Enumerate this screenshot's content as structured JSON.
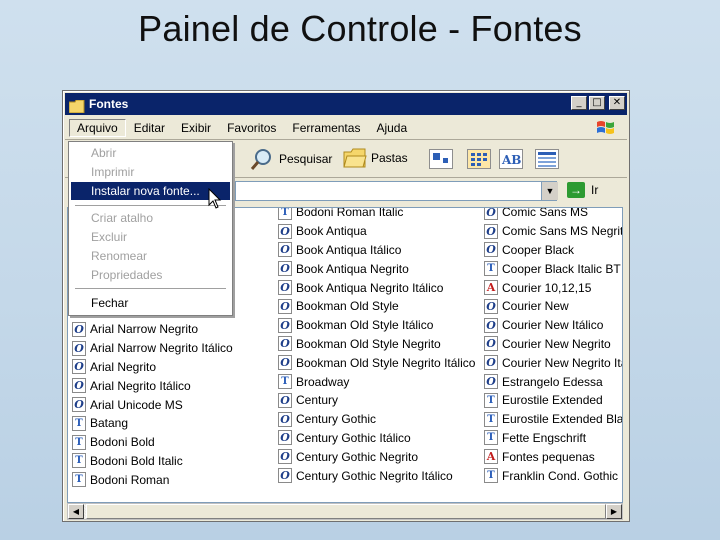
{
  "slide": {
    "title": "Painel de Controle - Fontes"
  },
  "window": {
    "title": "Fontes",
    "buttons": {
      "minimize": "_",
      "maximize": "□",
      "close": "✕"
    }
  },
  "menubar": {
    "items": [
      "Arquivo",
      "Editar",
      "Exibir",
      "Favoritos",
      "Ferramentas",
      "Ajuda"
    ]
  },
  "toolbar": {
    "search_label": "Pesquisar",
    "folders_label": "Pastas"
  },
  "addressbar": {
    "go_label": "Ir"
  },
  "arquivo_menu": {
    "items": [
      {
        "label": "Abrir",
        "enabled": false
      },
      {
        "label": "Imprimir",
        "enabled": false
      },
      {
        "label": "Instalar nova fonte...",
        "enabled": true,
        "highlighted": true
      },
      {
        "label": "Criar atalho",
        "enabled": false
      },
      {
        "label": "Excluir",
        "enabled": false
      },
      {
        "label": "Renomear",
        "enabled": false
      },
      {
        "label": "Propriedades",
        "enabled": false
      },
      {
        "label": "Fechar",
        "enabled": true
      }
    ]
  },
  "fonts": {
    "col1": [
      {
        "name": "Arial Narrow Negrito",
        "icon": "opentype"
      },
      {
        "name": "Arial Narrow Negrito Itálico",
        "icon": "opentype"
      },
      {
        "name": "Arial Negrito",
        "icon": "opentype"
      },
      {
        "name": "Arial Negrito Itálico",
        "icon": "opentype"
      },
      {
        "name": "Arial Unicode MS",
        "icon": "opentype"
      },
      {
        "name": "Batang",
        "icon": "truetype"
      },
      {
        "name": "Bodoni Bold",
        "icon": "truetype"
      },
      {
        "name": "Bodoni Bold Italic",
        "icon": "truetype"
      },
      {
        "name": "Bodoni Roman",
        "icon": "truetype"
      }
    ],
    "col2": [
      {
        "name": "Bodoni Roman Italic",
        "icon": "truetype"
      },
      {
        "name": "Book Antiqua",
        "icon": "opentype"
      },
      {
        "name": "Book Antiqua Itálico",
        "icon": "opentype"
      },
      {
        "name": "Book Antiqua Negrito",
        "icon": "opentype"
      },
      {
        "name": "Book Antiqua Negrito Itálico",
        "icon": "opentype"
      },
      {
        "name": "Bookman Old Style",
        "icon": "opentype"
      },
      {
        "name": "Bookman Old Style Itálico",
        "icon": "opentype"
      },
      {
        "name": "Bookman Old Style Negrito",
        "icon": "opentype"
      },
      {
        "name": "Bookman Old Style Negrito Itálico",
        "icon": "opentype"
      },
      {
        "name": "Broadway",
        "icon": "truetype"
      },
      {
        "name": "Century",
        "icon": "opentype"
      },
      {
        "name": "Century Gothic",
        "icon": "opentype"
      },
      {
        "name": "Century Gothic Itálico",
        "icon": "opentype"
      },
      {
        "name": "Century Gothic Negrito",
        "icon": "opentype"
      },
      {
        "name": "Century Gothic Negrito Itálico",
        "icon": "opentype"
      }
    ],
    "col3": [
      {
        "name": "Comic Sans MS",
        "icon": "opentype"
      },
      {
        "name": "Comic Sans MS Negrito",
        "icon": "opentype"
      },
      {
        "name": "Cooper Black",
        "icon": "opentype"
      },
      {
        "name": "Cooper Black Italic BT",
        "icon": "truetype"
      },
      {
        "name": "Courier 10,12,15",
        "icon": "raster"
      },
      {
        "name": "Courier New",
        "icon": "opentype"
      },
      {
        "name": "Courier New Itálico",
        "icon": "opentype"
      },
      {
        "name": "Courier New Negrito",
        "icon": "opentype"
      },
      {
        "name": "Courier New Negrito Itálico",
        "icon": "opentype"
      },
      {
        "name": "Estrangelo Edessa",
        "icon": "opentype"
      },
      {
        "name": "Eurostile Extended",
        "icon": "truetype"
      },
      {
        "name": "Eurostile Extended Black",
        "icon": "truetype"
      },
      {
        "name": "Fette Engschrift",
        "icon": "truetype"
      },
      {
        "name": "Fontes pequenas",
        "icon": "raster"
      },
      {
        "name": "Franklin Cond. Gothic",
        "icon": "truetype"
      }
    ]
  },
  "colors": {
    "titlebar": "#0a246a",
    "highlight": "#0a246a",
    "go": "#2c9a31"
  }
}
